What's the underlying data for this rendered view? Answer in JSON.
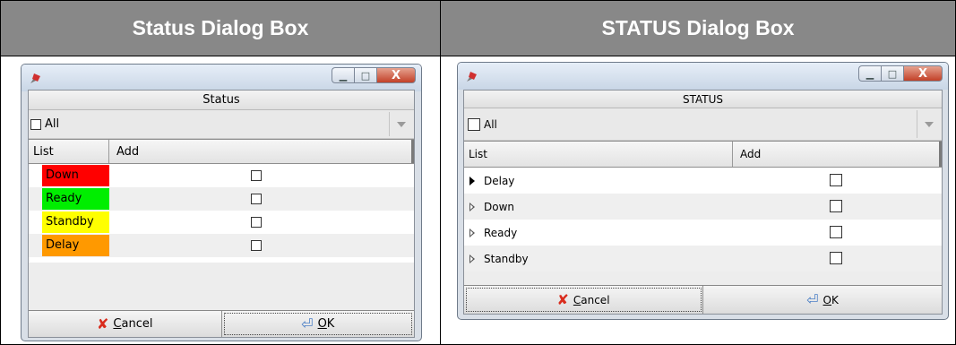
{
  "left": {
    "header": "Status Dialog Box",
    "caption": "Status",
    "filter_label": "All",
    "columns": [
      "List",
      "Add"
    ],
    "rows": [
      {
        "label": "Down",
        "color": "#ff0000"
      },
      {
        "label": "Ready",
        "color": "#00ee00"
      },
      {
        "label": "Standby",
        "color": "#ffff00"
      },
      {
        "label": "Delay",
        "color": "#ff9900"
      }
    ],
    "cancel_prefix": "",
    "cancel_u": "C",
    "cancel_rest": "ancel",
    "ok_u": "O",
    "ok_rest": "K"
  },
  "right": {
    "header": "STATUS Dialog Box",
    "caption": "STATUS",
    "filter_label": "All",
    "columns": [
      "List",
      "Add"
    ],
    "rows": [
      {
        "label": "Delay",
        "arrow": "solid"
      },
      {
        "label": "Down",
        "arrow": "hollow"
      },
      {
        "label": "Ready",
        "arrow": "hollow"
      },
      {
        "label": "Standby",
        "arrow": "hollow"
      }
    ],
    "cancel_u": "C",
    "cancel_rest": "ancel",
    "ok_u": "O",
    "ok_rest": "K"
  },
  "icons": {
    "app": "pin-icon",
    "minimize": "minimize-icon",
    "maximize": "maximize-icon",
    "close": "close-icon",
    "cancel": "x-icon",
    "ok": "enter-arrow-icon"
  }
}
